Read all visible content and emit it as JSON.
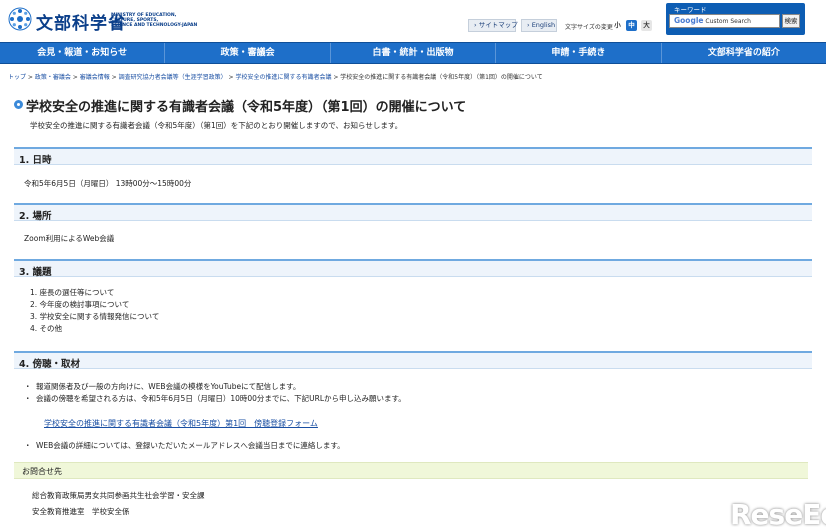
{
  "header": {
    "site_name": "文部科学省",
    "site_name_en": [
      "MINISTRY OF EDUCATION,",
      "CULTURE, SPORTS,",
      "SCIENCE AND TECHNOLOGY-JAPAN"
    ],
    "sitemap_label": "サイトマップ",
    "english_label": "English",
    "font_size_label": "文字サイズの変更",
    "font_sizes": [
      "小",
      "中",
      "大"
    ],
    "search_keyword_label": "キーワード",
    "search_placeholder_brand": "Google",
    "search_placeholder": "Custom Search",
    "search_button": "検索"
  },
  "nav": {
    "items": [
      "会見・報道・お知らせ",
      "政策・審議会",
      "白書・統計・出版物",
      "申請・手続き",
      "文部科学省の紹介"
    ]
  },
  "breadcrumb": {
    "items": [
      "トップ",
      "政策・審議会",
      "審議会情報",
      "調査研究協力者会議等（生涯学習政策）",
      "学校安全の推進に関する有識者会議"
    ],
    "current": "学校安全の推進に関する有識者会議（令和5年度）（第1回）の開催について"
  },
  "page": {
    "title": "学校安全の推進に関する有識者会議（令和5年度）（第1回）の開催について",
    "intro": "学校安全の推進に関する有識者会議（令和5年度）（第1回）を下記のとおり開催しますので、お知らせします。"
  },
  "sections": {
    "datetime": {
      "heading": "1. 日時",
      "text": "令和5年6月5日（月曜日） 13時00分～15時00分"
    },
    "place": {
      "heading": "2. 場所",
      "text": "Zoom利用によるWeb会議"
    },
    "agenda": {
      "heading": "3. 議題",
      "items": [
        "1. 座長の選任等について",
        "2. 今年度の検討事項について",
        "3. 学校安全に関する情報発信について",
        "4. その他"
      ]
    },
    "audience": {
      "heading": "4. 傍聴・取材",
      "bullets": [
        "報道関係者及び一般の方向けに、WEB会議の模様をYouTubeにて配信します。",
        "会議の傍聴を希望される方は、令和5年6月5日（月曜日）10時00分までに、下記URLから申し込み願います。"
      ],
      "form_link": "学校安全の推進に関する有識者会議（令和5年度）第1回　傍聴登録フォーム",
      "note": "WEB会議の詳細については、登録いただいたメールアドレスへ会議当日までに連絡します。"
    }
  },
  "contact": {
    "heading": "お問合せ先",
    "lines": [
      "総合教育政策局男女共同参画共生社会学習・安全課",
      "安全教育推進室　学校安全係"
    ]
  },
  "watermark": "ReseEd",
  "colors": {
    "nav_bg": "#1e6fc9",
    "brand": "#0b3f8a",
    "section_bg": "#eef4fb",
    "contact_bg": "#f0f7d9",
    "link": "#1a4fa3"
  }
}
